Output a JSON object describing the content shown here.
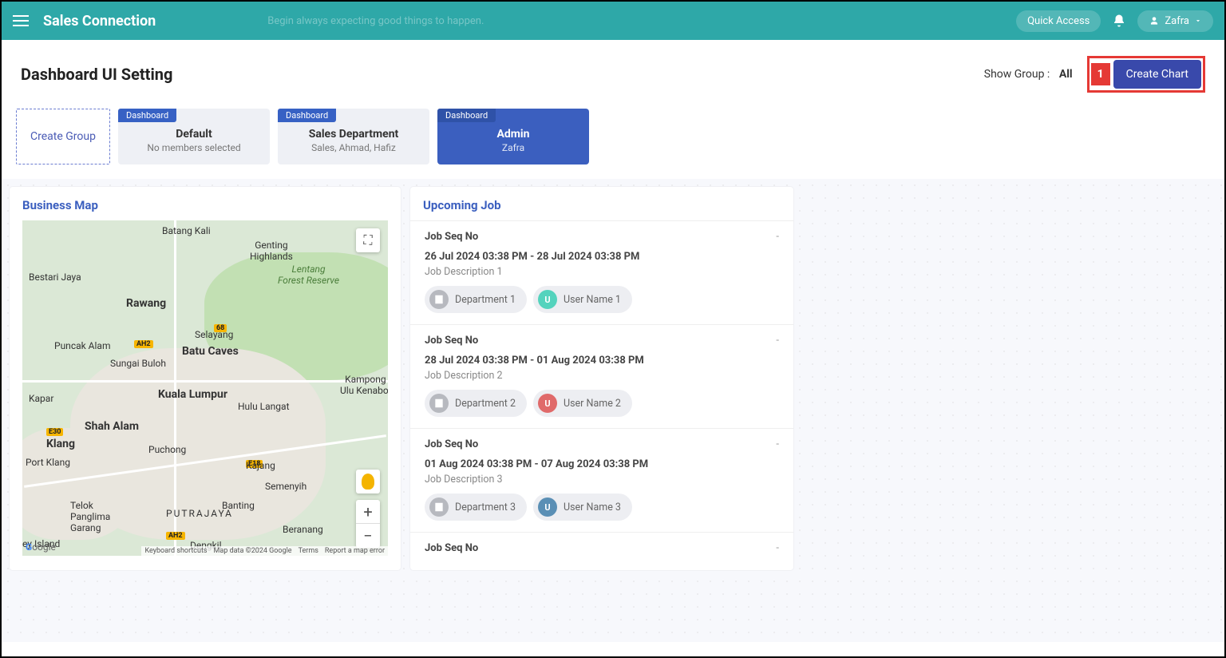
{
  "topbar": {
    "brand": "Sales Connection",
    "motto": "Begin always expecting good things to happen.",
    "quick_access": "Quick Access",
    "user": "Zafra"
  },
  "header": {
    "title": "Dashboard UI Setting",
    "show_group_label": "Show Group :",
    "show_group_value": "All",
    "callout_num": "1",
    "create_chart": "Create Chart"
  },
  "groups": {
    "create_label": "Create Group",
    "tag": "Dashboard",
    "items": [
      {
        "title": "Default",
        "sub": "No members selected"
      },
      {
        "title": "Sales Department",
        "sub": "Sales, Ahmad, Hafiz"
      },
      {
        "title": "Admin",
        "sub": "Zafra"
      }
    ]
  },
  "panels": {
    "map_title": "Business Map",
    "jobs_title": "Upcoming Job"
  },
  "map": {
    "labels": {
      "kl": "Kuala Lumpur",
      "putrajaya": "PUTRAJAYA",
      "shahalam": "Shah Alam",
      "klang": "Klang",
      "portklang": "Port Klang",
      "puchong": "Puchong",
      "kajang": "Kajang",
      "rawang": "Rawang",
      "batangkali": "Batang Kali",
      "genting": "Genting\nHighlands",
      "lentang": "Lentang\nForest Reserve",
      "ulukenaboi": "Kampong\nUlu Kenaboi",
      "batucaves": "Batu Caves",
      "semenyih": "Semenyih",
      "beranang": "Beranang",
      "dengkil": "Dengkil",
      "banting": "Banting",
      "hululangat": "Hulu Langat",
      "sungaibuloh": "Sungai Buloh",
      "selayang": "Selayang",
      "bestarijaya": "Bestari Jaya",
      "kapar": "Kapar",
      "puncakalam": "Puncak Alam",
      "telok": "Telok\nPanglima\nGarang",
      "eyisland": "ey Island"
    },
    "attr": {
      "shortcuts": "Keyboard shortcuts",
      "data": "Map data ©2024 Google",
      "terms": "Terms",
      "report": "Report a map error"
    }
  },
  "jobs": [
    {
      "seq": "Job Seq No",
      "date": "26 Jul 2024 03:38 PM - 28 Jul 2024 03:38 PM",
      "desc": "Job Description 1",
      "dept": "Department 1",
      "user": "User Name 1",
      "uc": "teal",
      "uinit": "U"
    },
    {
      "seq": "Job Seq No",
      "date": "28 Jul 2024 03:38 PM - 01 Aug 2024 03:38 PM",
      "desc": "Job Description 2",
      "dept": "Department 2",
      "user": "User Name 2",
      "uc": "red",
      "uinit": "U"
    },
    {
      "seq": "Job Seq No",
      "date": "01 Aug 2024 03:38 PM - 07 Aug 2024 03:38 PM",
      "desc": "Job Description 3",
      "dept": "Department 3",
      "user": "User Name 3",
      "uc": "blue",
      "uinit": "U"
    },
    {
      "seq": "Job Seq No"
    }
  ]
}
